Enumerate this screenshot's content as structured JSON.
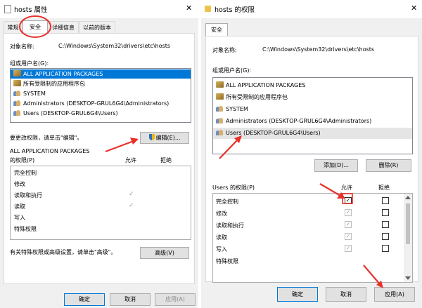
{
  "left_dialog": {
    "title": "hosts 属性",
    "tabs": [
      {
        "label": "常规",
        "selected": false
      },
      {
        "label": "安全",
        "selected": true
      },
      {
        "label": "详细信息",
        "selected": false
      },
      {
        "label": "以前的版本",
        "selected": false
      }
    ],
    "object_name_label": "对象名称:",
    "object_name_value": "C:\\Windows\\System32\\drivers\\etc\\hosts",
    "groups_label": "组或用户名(G):",
    "groups": [
      {
        "name": "ALL APPLICATION PACKAGES",
        "icon": "package-icon",
        "selected": true
      },
      {
        "name": "所有受限制的应用程序包",
        "icon": "package-icon",
        "selected": false
      },
      {
        "name": "SYSTEM",
        "icon": "users-icon",
        "selected": false
      },
      {
        "name": "Administrators (DESKTOP-GRUL6G4\\Administrators)",
        "icon": "users-icon",
        "selected": false
      },
      {
        "name": "Users (DESKTOP-GRUL6G4\\Users)",
        "icon": "users-icon",
        "selected": false
      }
    ],
    "edit_hint": "要更改权限，请单击\"编辑\"。",
    "edit_button": "编辑(E)...",
    "perm_title_line1": "ALL APPLICATION PACKAGES",
    "perm_title_line2": "的权限(P)",
    "allow_header": "允许",
    "deny_header": "拒绝",
    "permissions": [
      {
        "name": "完全控制",
        "allow": false,
        "deny": false
      },
      {
        "name": "修改",
        "allow": false,
        "deny": false
      },
      {
        "name": "读取和执行",
        "allow": true,
        "deny": false
      },
      {
        "name": "读取",
        "allow": true,
        "deny": false
      },
      {
        "name": "写入",
        "allow": false,
        "deny": false
      },
      {
        "name": "特殊权限",
        "allow": false,
        "deny": false
      }
    ],
    "advanced_hint": "有关特殊权限或高级设置，请单击\"高级\"。",
    "advanced_button": "高级(V)",
    "ok_button": "确定",
    "cancel_button": "取消",
    "apply_button": "应用(A)"
  },
  "right_dialog": {
    "title": "hosts 的权限",
    "tab": "安全",
    "object_name_label": "对象名称:",
    "object_name_value": "C:\\Windows\\System32\\drivers\\etc\\hosts",
    "groups_label": "组或用户名(G):",
    "groups": [
      {
        "name": "ALL APPLICATION PACKAGES",
        "icon": "package-icon",
        "selected": false
      },
      {
        "name": "所有受限制的应用程序包",
        "icon": "package-icon",
        "selected": false
      },
      {
        "name": "SYSTEM",
        "icon": "users-icon",
        "selected": false
      },
      {
        "name": "Administrators (DESKTOP-GRUL6G4\\Administrators)",
        "icon": "users-icon",
        "selected": false
      },
      {
        "name": "Users (DESKTOP-GRUL6G4\\Users)",
        "icon": "users-icon",
        "selected": true
      }
    ],
    "add_button": "添加(D)...",
    "remove_button": "删除(R)",
    "perm_title": "Users 的权限(P)",
    "allow_header": "允许",
    "deny_header": "拒绝",
    "permissions": [
      {
        "name": "完全控制",
        "allow": true,
        "allow_enabled": true,
        "deny": false
      },
      {
        "name": "修改",
        "allow": true,
        "allow_enabled": false,
        "deny": false
      },
      {
        "name": "读取和执行",
        "allow": true,
        "allow_enabled": false,
        "deny": false
      },
      {
        "name": "读取",
        "allow": true,
        "allow_enabled": false,
        "deny": false
      },
      {
        "name": "写入",
        "allow": true,
        "allow_enabled": false,
        "deny": false
      },
      {
        "name": "特殊权限",
        "allow": false,
        "allow_enabled": false,
        "deny": false
      }
    ],
    "ok_button": "确定",
    "cancel_button": "取消",
    "apply_button": "应用(A)"
  },
  "glyphs": {
    "close": "✕",
    "check": "✓"
  },
  "annotation_color": "#e8302a"
}
